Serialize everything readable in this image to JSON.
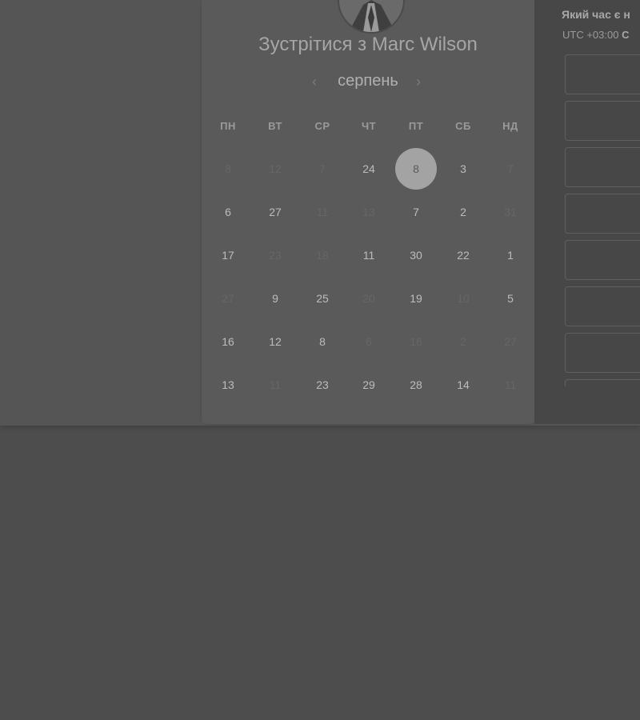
{
  "host": {
    "title": "Зустрітися з Marc Wilson"
  },
  "calendar": {
    "month": "серпень",
    "weekdays": [
      "ПН",
      "ВТ",
      "СР",
      "ЧТ",
      "ПТ",
      "СБ",
      "НД"
    ],
    "rows": [
      [
        {
          "t": "8",
          "s": "muted"
        },
        {
          "t": "12",
          "s": "muted"
        },
        {
          "t": "7",
          "s": "muted"
        },
        {
          "t": "24",
          "s": "avail"
        },
        {
          "t": "8",
          "s": "sel"
        },
        {
          "t": "3",
          "s": "avail"
        },
        {
          "t": "7",
          "s": "muted"
        }
      ],
      [
        {
          "t": "6",
          "s": "avail"
        },
        {
          "t": "27",
          "s": "avail"
        },
        {
          "t": "11",
          "s": "muted"
        },
        {
          "t": "13",
          "s": "muted"
        },
        {
          "t": "7",
          "s": "avail"
        },
        {
          "t": "2",
          "s": "avail"
        },
        {
          "t": "31",
          "s": "muted"
        }
      ],
      [
        {
          "t": "17",
          "s": "avail"
        },
        {
          "t": "23",
          "s": "muted"
        },
        {
          "t": "18",
          "s": "muted"
        },
        {
          "t": "11",
          "s": "avail"
        },
        {
          "t": "30",
          "s": "avail"
        },
        {
          "t": "22",
          "s": "avail"
        },
        {
          "t": "1",
          "s": "avail"
        }
      ],
      [
        {
          "t": "27",
          "s": "muted"
        },
        {
          "t": "9",
          "s": "avail"
        },
        {
          "t": "25",
          "s": "avail"
        },
        {
          "t": "20",
          "s": "muted"
        },
        {
          "t": "19",
          "s": "avail"
        },
        {
          "t": "10",
          "s": "muted"
        },
        {
          "t": "5",
          "s": "avail"
        }
      ],
      [
        {
          "t": "16",
          "s": "avail"
        },
        {
          "t": "12",
          "s": "avail"
        },
        {
          "t": "8",
          "s": "avail"
        },
        {
          "t": "6",
          "s": "muted"
        },
        {
          "t": "16",
          "s": "muted"
        },
        {
          "t": "2",
          "s": "muted"
        },
        {
          "t": "27",
          "s": "muted"
        }
      ],
      [
        {
          "t": "13",
          "s": "avail"
        },
        {
          "t": "11",
          "s": "muted"
        },
        {
          "t": "23",
          "s": "avail"
        },
        {
          "t": "29",
          "s": "avail"
        },
        {
          "t": "28",
          "s": "avail"
        },
        {
          "t": "14",
          "s": "avail"
        },
        {
          "t": "11",
          "s": "muted"
        }
      ]
    ]
  },
  "time_panel": {
    "title": "Який час є н",
    "tz_prefix": "UTC +03:00",
    "tz_suffix": "С",
    "slot_count": 7
  },
  "icons": {
    "prev": "chevron-left-icon",
    "next": "chevron-right-icon",
    "avatar": "avatar-photo"
  },
  "colors": {
    "selected_day_bg": "#a3a3a3",
    "background": "#4d4d4d"
  }
}
